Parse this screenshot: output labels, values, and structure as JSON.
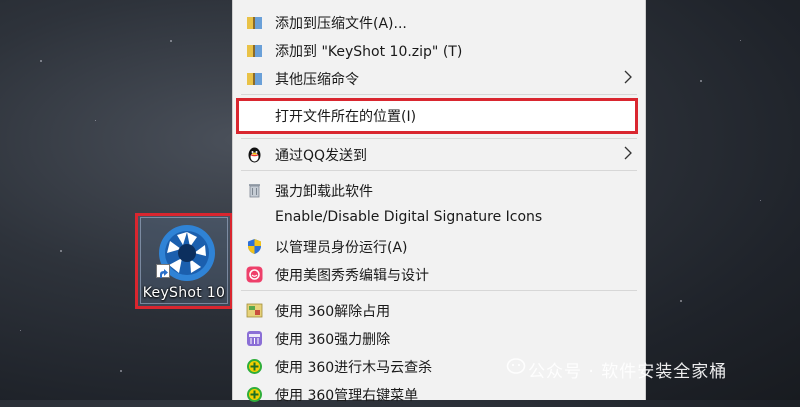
{
  "desktop": {
    "shortcut_label": "KeyShot 10"
  },
  "context_menu": {
    "items": [
      {
        "label": "添加到压缩文件(A)...",
        "icon": "archive-icon"
      },
      {
        "label": "添加到 \"KeyShot 10.zip\" (T)",
        "icon": "archive-icon"
      },
      {
        "label": "其他压缩命令",
        "icon": "archive-icon",
        "submenu": true
      },
      {
        "label": "打开文件所在的位置(I)",
        "icon": "",
        "highlighted": true
      },
      {
        "label": "通过QQ发送到",
        "icon": "qq-penguin-icon",
        "submenu": true
      },
      {
        "label": "强力卸载此软件",
        "icon": "trash-icon"
      },
      {
        "label": "Enable/Disable Digital Signature Icons",
        "icon": ""
      },
      {
        "label": "以管理员身份运行(A)",
        "icon": "uac-shield-icon"
      },
      {
        "label": "使用美图秀秀编辑与设计",
        "icon": "meitu-icon"
      },
      {
        "label": "使用 360解除占用",
        "icon": "unlock-360-icon"
      },
      {
        "label": "使用 360强力删除",
        "icon": "shred-360-icon"
      },
      {
        "label": "使用 360进行木马云查杀",
        "icon": "scan-360-icon"
      },
      {
        "label": "使用 360管理右键菜单",
        "icon": "scan-360-icon"
      }
    ]
  },
  "watermark": {
    "text": "公众号 · 软件安装全家桶"
  },
  "colors": {
    "highlight_border": "#d9262f",
    "menu_background": "#f2f2f2"
  }
}
